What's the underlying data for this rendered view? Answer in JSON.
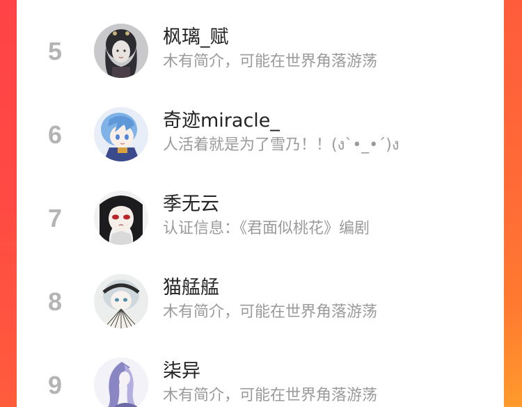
{
  "colors": {
    "accent_left": "#ff4347",
    "accent_right": "#ff7a30",
    "rank_gray": "#b4b4b4",
    "name_text": "#222222",
    "bio_text": "#9a9a9a"
  },
  "ranking": {
    "items": [
      {
        "rank": "5",
        "name": "枫璃_赋",
        "bio": "木有简介，可能在世界角落游荡",
        "avatar_icon": "avatar-dark-hair-girl"
      },
      {
        "rank": "6",
        "name": "奇迹miracle_",
        "bio": "人活着就是为了雪乃！！(ง`•_•´)ง",
        "avatar_icon": "avatar-blue-hair-girl"
      },
      {
        "rank": "7",
        "name": "季无云",
        "bio": "认证信息：《君面似桃花》编剧",
        "avatar_icon": "avatar-black-hair-red-eyes"
      },
      {
        "rank": "8",
        "name": "猫艋艋",
        "bio": "木有简介，可能在世界角落游荡",
        "avatar_icon": "avatar-silver-hair-fan"
      },
      {
        "rank": "9",
        "name": "柒异",
        "bio": "木有简介，可能在世界角落游荡",
        "avatar_icon": "avatar-purple-hair-girl"
      }
    ]
  }
}
